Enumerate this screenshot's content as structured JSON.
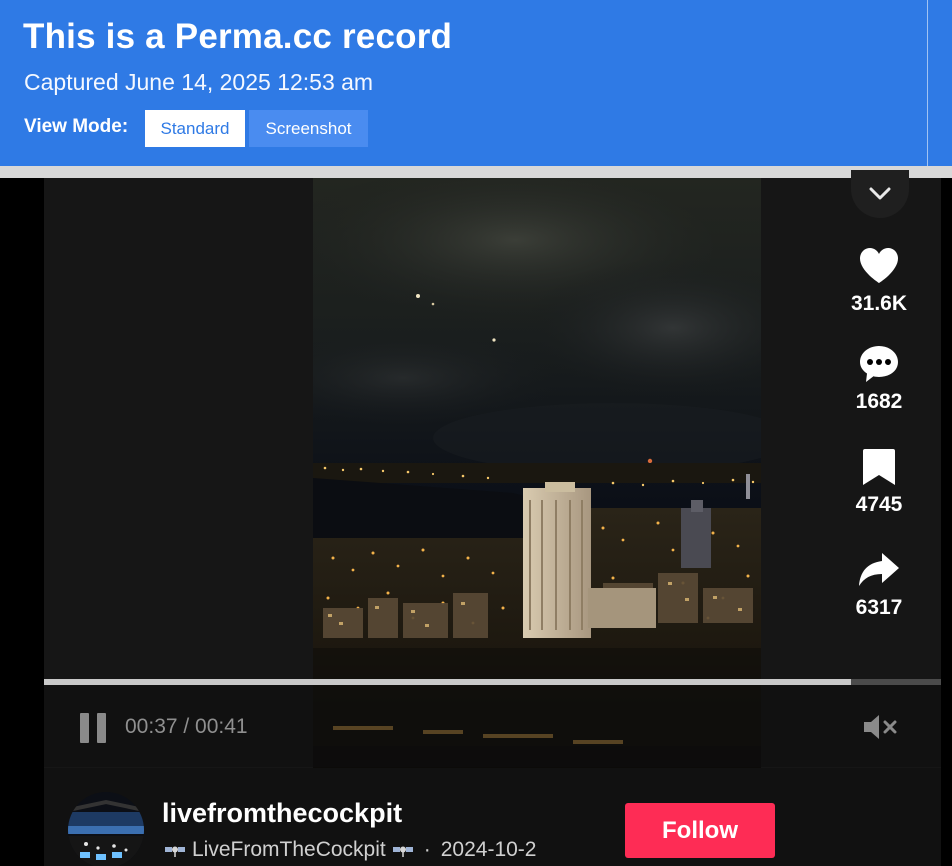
{
  "banner": {
    "title": "This is a Perma.cc record",
    "captured": "Captured June 14, 2025 12:53 am",
    "view_mode_label": "View Mode:",
    "modes": [
      "Standard",
      "Screenshot"
    ],
    "active_mode": "Standard",
    "background_color": "#2f7ae5"
  },
  "video": {
    "collapse_icon": "chevron-down-icon",
    "time": "00:37 / 00:41",
    "progress": 0.9,
    "mute_icon": "speaker-muted-icon",
    "pause_icon": "pause-icon"
  },
  "actions": [
    {
      "icon": "heart-icon",
      "count": "31.6K"
    },
    {
      "icon": "comment-icon",
      "count": "1682"
    },
    {
      "icon": "bookmark-icon",
      "count": "4745"
    },
    {
      "icon": "share-icon",
      "count": "6317"
    }
  ],
  "author": {
    "username": "livefromthecockpit",
    "display_name": "LiveFromTheCockpit",
    "date": "2024-10-2",
    "follow_label": "Follow",
    "follow_color": "#fe2c55"
  }
}
